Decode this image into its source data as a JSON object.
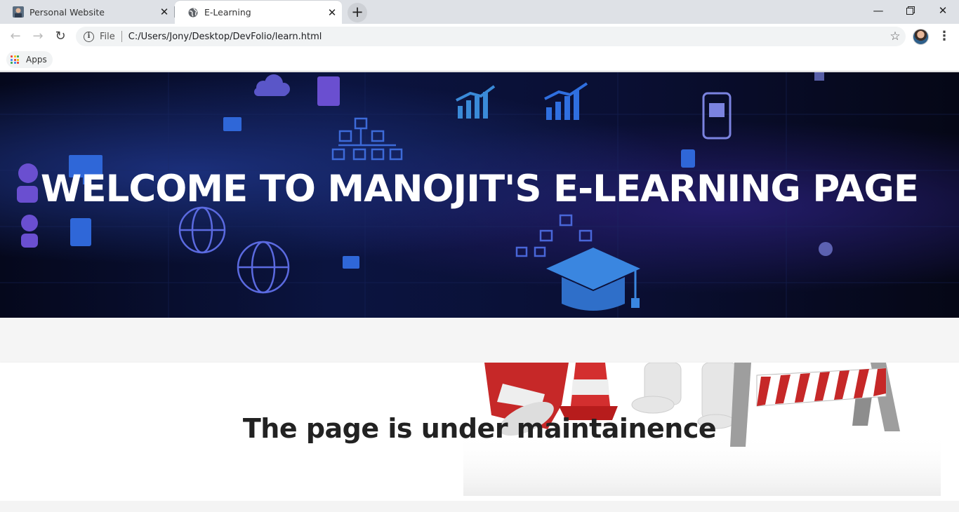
{
  "browser": {
    "tabs": [
      {
        "title": "Personal Website",
        "active": false
      },
      {
        "title": "E-Learning",
        "active": true
      }
    ],
    "url_scheme_label": "File",
    "url": "C:/Users/Jony/Desktop/DevFolio/learn.html",
    "bookmarks": [
      {
        "label": "Apps",
        "icon": "apps-grid-icon"
      }
    ]
  },
  "hero": {
    "title": "WELCOME TO MANOJIT'S E-LEARNING PAGE"
  },
  "maintenance": {
    "message": "The page is under maintainence"
  },
  "colors": {
    "hero_bg": "#0a1038",
    "hero_accent": "#3a7bd5",
    "tabstrip": "#dee1e6",
    "cone_red": "#d32f2f"
  }
}
